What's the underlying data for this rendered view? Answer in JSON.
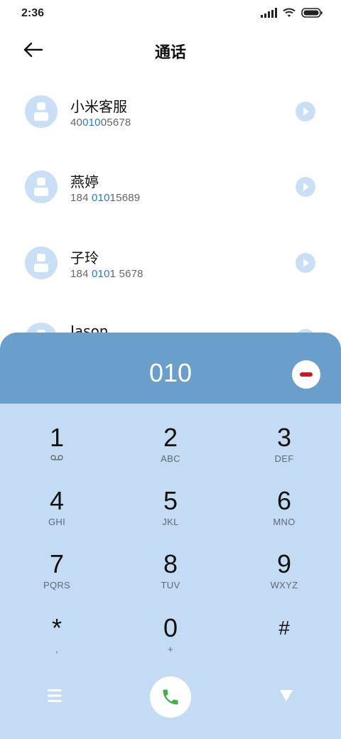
{
  "status_bar": {
    "time": "2:36",
    "icons": [
      "signal-icon",
      "wifi-icon",
      "battery-icon"
    ]
  },
  "header": {
    "title": "通话",
    "back_icon": "back-arrow-icon"
  },
  "contacts": [
    {
      "name": "小米客服",
      "number_pre": "40",
      "number_match": "010",
      "number_post": "05678"
    },
    {
      "name": "燕婷",
      "number_pre": "184 ",
      "number_match": "010",
      "number_post": "15689"
    },
    {
      "name": "子玲",
      "number_pre": "184 ",
      "number_match": "010",
      "number_post": "1 5678"
    },
    {
      "name": "Jason",
      "number_pre": "",
      "number_match": "",
      "number_post": ""
    }
  ],
  "dialer": {
    "number": "010",
    "keys": [
      {
        "digit": "1",
        "letters": ""
      },
      {
        "digit": "2",
        "letters": "ABC"
      },
      {
        "digit": "3",
        "letters": "DEF"
      },
      {
        "digit": "4",
        "letters": "GHI"
      },
      {
        "digit": "5",
        "letters": "JKL"
      },
      {
        "digit": "6",
        "letters": "MNO"
      },
      {
        "digit": "7",
        "letters": "PQRS"
      },
      {
        "digit": "8",
        "letters": "TUV"
      },
      {
        "digit": "9",
        "letters": "WXYZ"
      },
      {
        "digit": "*",
        "letters": ","
      },
      {
        "digit": "0",
        "letters": "+"
      },
      {
        "digit": "#",
        "letters": ""
      }
    ],
    "icons": [
      "voicemail-icon",
      "menu-icon",
      "phone-icon",
      "collapse-icon",
      "delete-icon"
    ]
  },
  "colors": {
    "accent": "#1f7ad8",
    "panel": "#c3dbf3",
    "display": "#6a9ecb",
    "call_icon": "#3db14a",
    "delete": "#c41e22"
  }
}
